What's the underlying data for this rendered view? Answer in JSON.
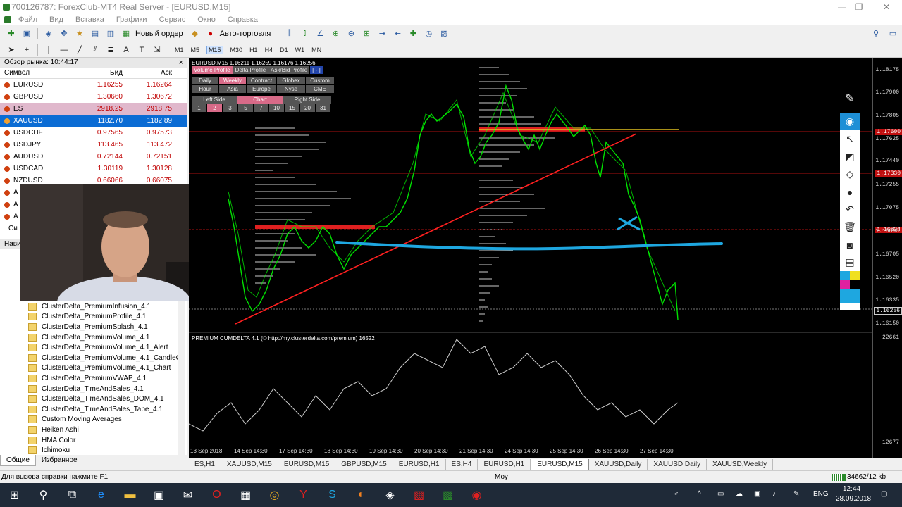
{
  "window": {
    "title": "700126787: ForexClub-MT4 Real Server - [EURUSD,M15]",
    "minimize": "—",
    "restore": "❐",
    "close": "✕"
  },
  "menu": [
    "Файл",
    "Вид",
    "Вставка",
    "Графики",
    "Сервис",
    "Окно",
    "Справка"
  ],
  "toolbar": {
    "new_order": "Новый ордер",
    "auto_trading": "Авто-торговля",
    "timeframes": [
      "M1",
      "M5",
      "M15",
      "M30",
      "H1",
      "H4",
      "D1",
      "W1",
      "MN"
    ],
    "active_timeframe": "M15"
  },
  "market_watch": {
    "header": "Обзор рынка: 10:44:17",
    "cols": {
      "symbol": "Символ",
      "bid": "Бид",
      "ask": "Аск"
    },
    "rows": [
      {
        "sym": "EURUSD",
        "bid": "1.16255",
        "ask": "1.16264"
      },
      {
        "sym": "GBPUSD",
        "bid": "1.30660",
        "ask": "1.30672"
      },
      {
        "sym": "ES",
        "bid": "2918.25",
        "ask": "2918.75"
      },
      {
        "sym": "XAUUSD",
        "bid": "1182.70",
        "ask": "1182.89"
      },
      {
        "sym": "USDCHF",
        "bid": "0.97565",
        "ask": "0.97573"
      },
      {
        "sym": "USDJPY",
        "bid": "113.465",
        "ask": "113.472"
      },
      {
        "sym": "AUDUSD",
        "bid": "0.72144",
        "ask": "0.72151"
      },
      {
        "sym": "USDCAD",
        "bid": "1.30119",
        "ask": "1.30128"
      },
      {
        "sym": "NZDUSD",
        "bid": "0.66066",
        "ask": "0.66075"
      }
    ],
    "partial": [
      "A",
      "A",
      "A",
      "Си"
    ]
  },
  "navigator": {
    "header": "Нави",
    "items": [
      "ClusterDelta_PremiumInfusion_4.1",
      "ClusterDelta_PremiumProfile_4.1",
      "ClusterDelta_PremiumSplash_4.1",
      "ClusterDelta_PremiumVolume_4.1",
      "ClusterDelta_PremiumVolume_4.1_Alert",
      "ClusterDelta_PremiumVolume_4.1_CandleC",
      "ClusterDelta_PremiumVolume_4.1_Chart",
      "ClusterDelta_PremiumVWAP_4.1",
      "ClusterDelta_TimeAndSales_4.1",
      "ClusterDelta_TimeAndSales_DOM_4.1",
      "ClusterDelta_TimeAndSales_Tape_4.1",
      "Custom Moving Averages",
      "Heiken Ashi",
      "HMA Color",
      "Ichimoku"
    ],
    "tabs": [
      "Общие",
      "Избранное"
    ]
  },
  "chart": {
    "title": "EURUSD,M15  1.16211 1.16259 1.16176 1.16256",
    "volume_panel": {
      "row1": [
        "Volume Profile",
        "Delta Profile",
        "Ask/Bid Profile",
        "[ - ]"
      ],
      "row2": [
        "Daily",
        "Weekly",
        "Contract",
        "Globex",
        "Custom"
      ],
      "row3": [
        "Hour",
        "Asia",
        "Europe",
        "Nyse",
        "CME"
      ],
      "row4": [
        "Left Side",
        "Chart",
        "Right Side"
      ],
      "row5": [
        "1",
        "2",
        "3",
        "5",
        "7",
        "10",
        "15",
        "20",
        "31"
      ]
    },
    "price_labels": [
      "1.18175",
      "1.17900",
      "1.17805",
      "1.17625",
      "1.17440",
      "1.17255",
      "1.17075",
      "1.16890",
      "1.16705",
      "1.16520",
      "1.16335",
      "1.16150"
    ],
    "price_tags": [
      "1.17600",
      "1.17330",
      "1.16834",
      "1.16256"
    ],
    "indicator_title": "PREMIUM CUMDELTA 4.1 (© http://my.clusterdelta.com/premium) 16522",
    "indicator_scale": [
      "22661",
      "12677"
    ],
    "time_labels": [
      "13 Sep 2018",
      "14 Sep 14:30",
      "17 Sep 14:30",
      "18 Sep 14:30",
      "19 Sep 14:30",
      "20 Sep 14:30",
      "21 Sep 14:30",
      "24 Sep 14:30",
      "25 Sep 14:30",
      "26 Sep 14:30",
      "27 Sep 14:30"
    ]
  },
  "chart_tabs": [
    "ES,H1",
    "XAUUSD,M15",
    "EURUSD,M15",
    "GBPUSD,M15",
    "EURUSD,H1",
    "ES,H4",
    "EURUSD,H1",
    "EURUSD,M15",
    "XAUUSD,Daily",
    "XAUUSD,Daily",
    "XAUUSD,Weekly"
  ],
  "active_chart_tab": 7,
  "status": {
    "help": "Для вызова справки нажмите F1",
    "profile": "Моу",
    "traffic": "34662/12 kb"
  },
  "taskbar": {
    "lang": "ENG",
    "time": "12:44",
    "date": "28.09.2018"
  },
  "colors": {
    "chart_bg": "#000000",
    "candles": "#00ff00",
    "trendline": "#ff2020",
    "hline": "#1ea7e0",
    "selection": "#0b6cd4"
  }
}
